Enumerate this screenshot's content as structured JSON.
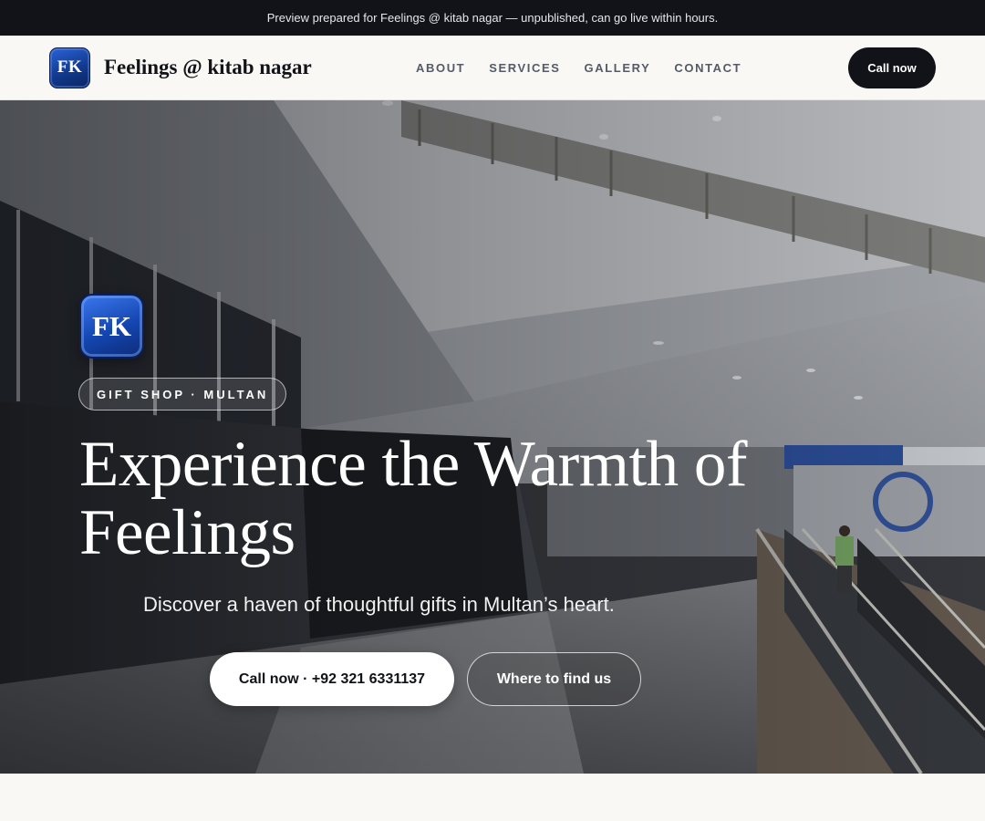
{
  "preview_banner": "Preview prepared for Feelings @ kitab nagar — unpublished, can go live within hours.",
  "header": {
    "logo_text": "FK",
    "brand_name": "Feelings @ kitab nagar",
    "nav": [
      "ABOUT",
      "SERVICES",
      "GALLERY",
      "CONTACT"
    ],
    "cta": "Call now"
  },
  "hero": {
    "logo_text": "FK",
    "tag": "GIFT SHOP · MULTAN",
    "title": "Experience the Warmth of Feelings",
    "subtitle": "Discover a haven of thoughtful gifts in Multan’s heart.",
    "primary_button": "Call now · +92 321 6331137",
    "secondary_button": "Where to find us"
  },
  "colors": {
    "dark": "#111318",
    "background": "#f9f8f5",
    "logo_blue": "#1446b0",
    "nav_text": "#555a66"
  }
}
